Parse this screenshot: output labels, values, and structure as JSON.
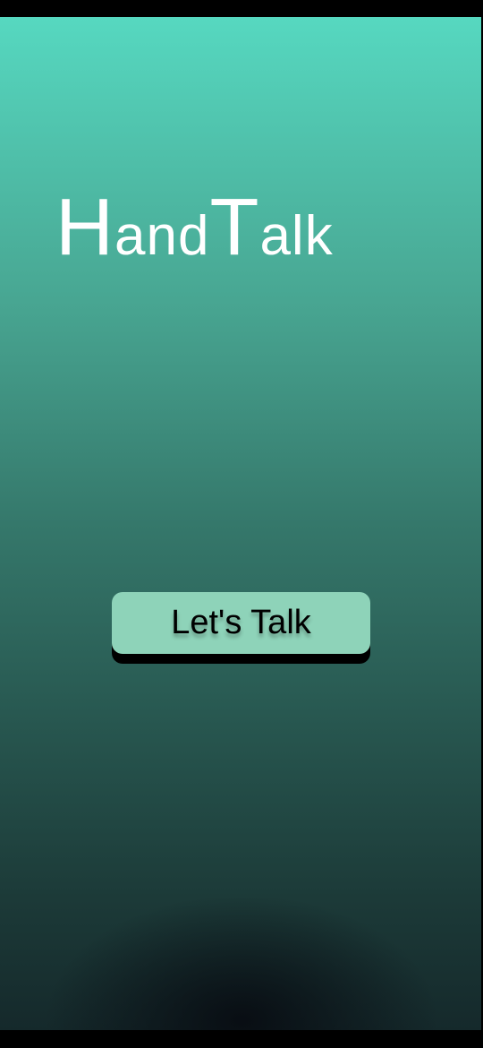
{
  "app": {
    "title_parts": [
      {
        "text": "H",
        "cap": true
      },
      {
        "text": "and",
        "cap": false
      },
      {
        "text": "T",
        "cap": true
      },
      {
        "text": "alk",
        "cap": false
      }
    ],
    "title": "HandTalk"
  },
  "main": {
    "cta_label": "Let's Talk"
  },
  "colors": {
    "gradient_top": "#56d8c0",
    "gradient_bottom": "#15292b",
    "button": "#8ed3b9"
  }
}
